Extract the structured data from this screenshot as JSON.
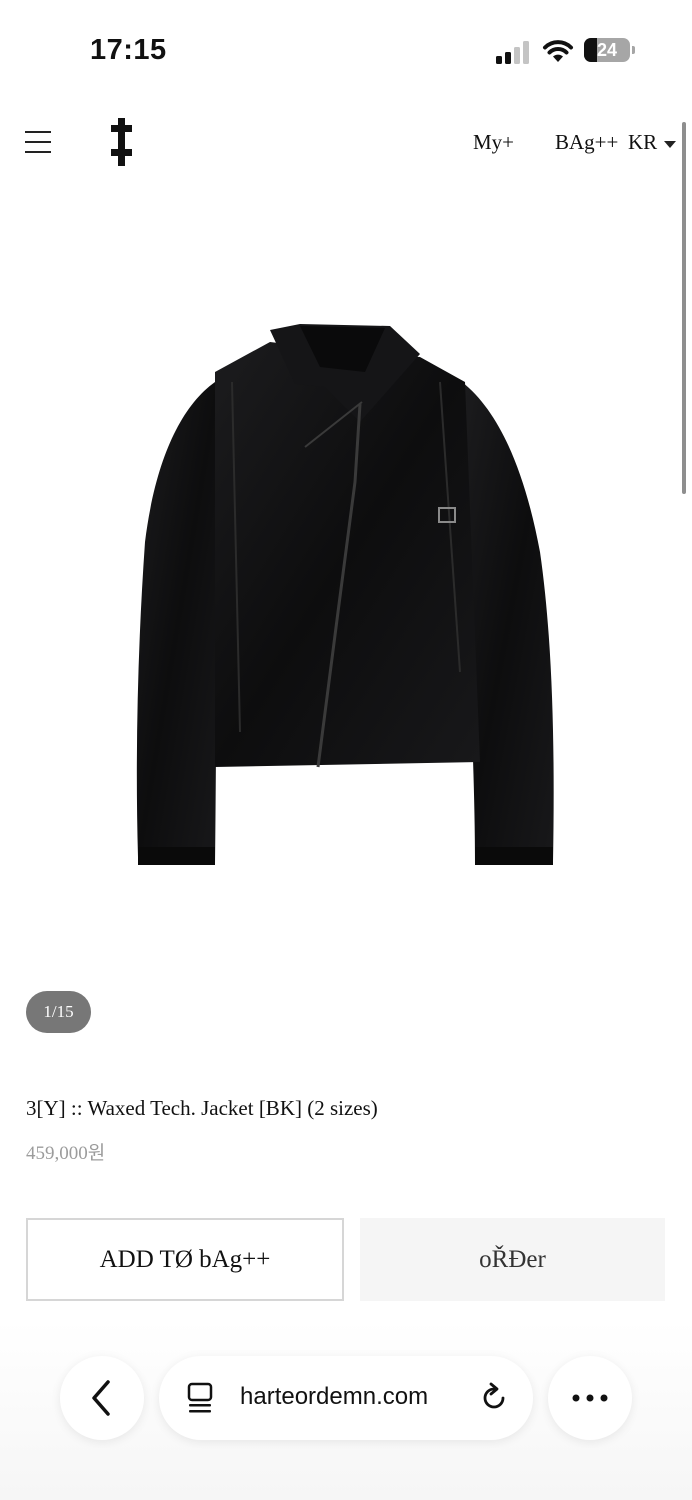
{
  "status_bar": {
    "time": "17:15",
    "battery_level": "24",
    "icons": [
      "signal-icon",
      "wifi-icon",
      "battery-icon"
    ]
  },
  "header": {
    "icons": [
      "menu-icon",
      "brand-logo-icon",
      "caret-down-icon"
    ],
    "my_label": "My+",
    "bag_label": "BAg++",
    "currency_label": "KR"
  },
  "gallery": {
    "counter": "1/15"
  },
  "product": {
    "title": "3[Y] :: Waxed Tech. Jacket [BK] (2 sizes)",
    "price": "459,000원"
  },
  "actions": {
    "add_to_bag_label": "ADD TØ bAg++",
    "order_label": "oŘĐer"
  },
  "browser": {
    "url": "harteordemn.com",
    "icons": [
      "back-icon",
      "tabs-icon",
      "reload-icon",
      "more-icon"
    ]
  },
  "colors": {
    "text": "#111111",
    "price": "#9c9c9c",
    "counter_bg": "#777777",
    "order_bg": "#f5f5f5",
    "border": "#d6d6d6"
  }
}
